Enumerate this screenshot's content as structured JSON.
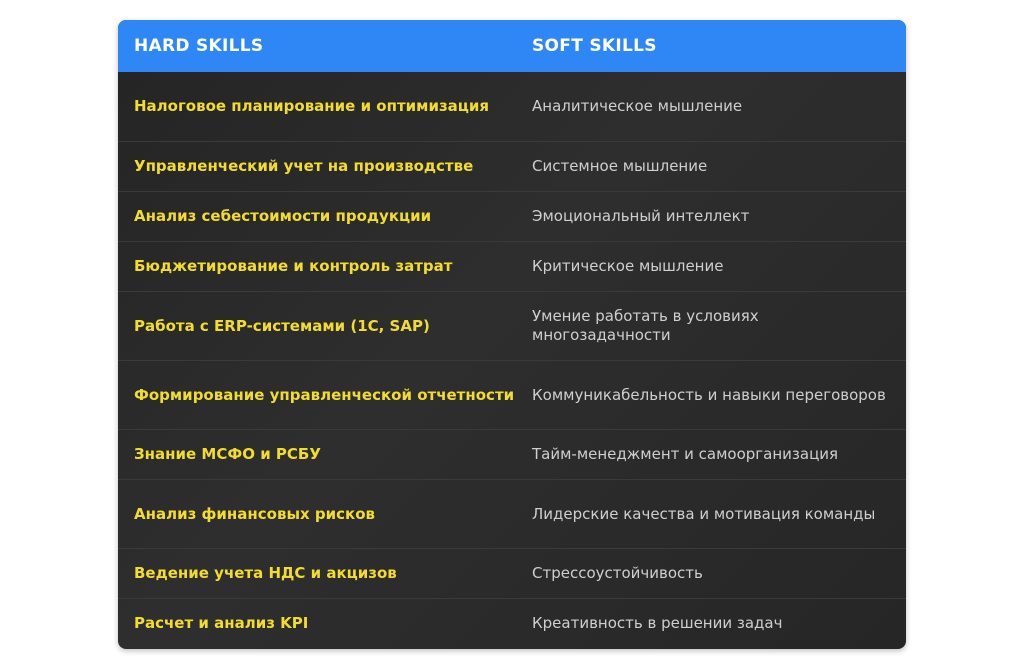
{
  "header": {
    "hard": "HARD SKILLS",
    "soft": "SOFT SKILLS"
  },
  "rows": [
    {
      "hard": "Налоговое планирование и оптимизация",
      "soft": "Аналитическое мышление"
    },
    {
      "hard": "Управленческий учет на производстве",
      "soft": "Системное мышление"
    },
    {
      "hard": "Анализ себестоимости продукции",
      "soft": "Эмоциональный интеллект"
    },
    {
      "hard": "Бюджетирование и контроль затрат",
      "soft": "Критическое мышление"
    },
    {
      "hard": "Работа с ERP-системами (1С, SAP)",
      "soft": "Умение работать в условиях многозадачности"
    },
    {
      "hard": "Формирование управленческой отчетности",
      "soft": "Коммуникабельность и навыки переговоров"
    },
    {
      "hard": "Знание МСФО и РСБУ",
      "soft": "Тайм-менеджмент и самоорганизация"
    },
    {
      "hard": "Анализ финансовых рисков",
      "soft": "Лидерские качества и мотивация команды"
    },
    {
      "hard": "Ведение учета НДС и акцизов",
      "soft": "Стрессоустойчивость"
    },
    {
      "hard": "Расчет и анализ KPI",
      "soft": "Креативность в решении задач"
    }
  ],
  "colors": {
    "header_bg": "#2f86f5",
    "hard_text": "#f2dc2e",
    "soft_text": "#cfcfcf",
    "table_bg": "#2a2a2a"
  }
}
